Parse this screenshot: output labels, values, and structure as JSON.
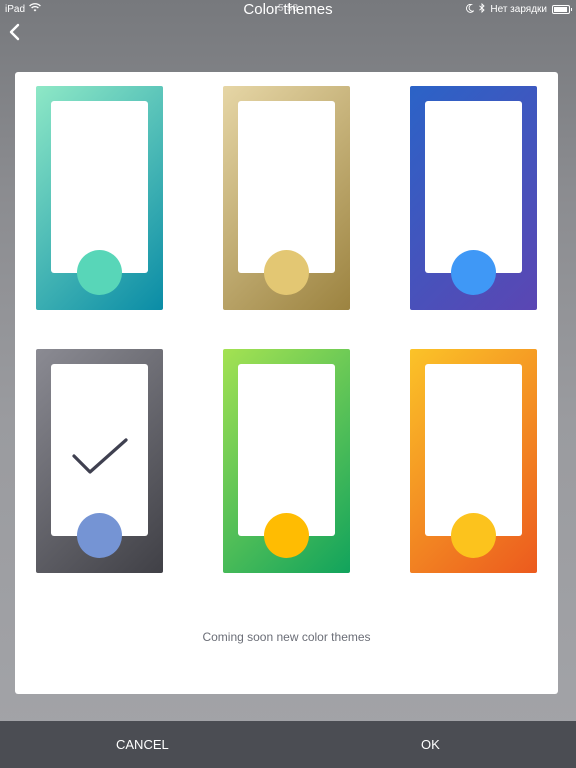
{
  "status_bar": {
    "device": "iPad",
    "time": "5:58",
    "charging_text": "Нет зарядки",
    "battery_level": 0.9
  },
  "header": {
    "title": "Color themes"
  },
  "themes": [
    {
      "gradient": [
        "#8ee8c6",
        "#0a8ca6"
      ],
      "dot": "#58d6b8",
      "selected": false
    },
    {
      "gradient": [
        "#e6d6a6",
        "#9c8340"
      ],
      "dot": "#e3c773",
      "selected": false
    },
    {
      "gradient": [
        "#2b63c7",
        "#5b46b3"
      ],
      "dot": "#3f98f6",
      "selected": false
    },
    {
      "gradient": [
        "#8b8b93",
        "#404046"
      ],
      "dot": "#7594d4",
      "selected": true
    },
    {
      "gradient": [
        "#a4e252",
        "#11a35c"
      ],
      "dot": "#ffbc02",
      "selected": false
    },
    {
      "gradient": [
        "#fbc328",
        "#ec5a1e"
      ],
      "dot": "#fcc31d",
      "selected": false
    }
  ],
  "footer_note": "Coming soon new color themes",
  "bottom_bar": {
    "cancel_label": "CANCEL",
    "ok_label": "OK"
  },
  "icons": {
    "back": "chevron-left-icon",
    "check": "checkmark-icon",
    "wifi": "wifi-icon",
    "moon": "moon-icon",
    "bluetooth": "bluetooth-icon",
    "battery": "battery-icon"
  }
}
